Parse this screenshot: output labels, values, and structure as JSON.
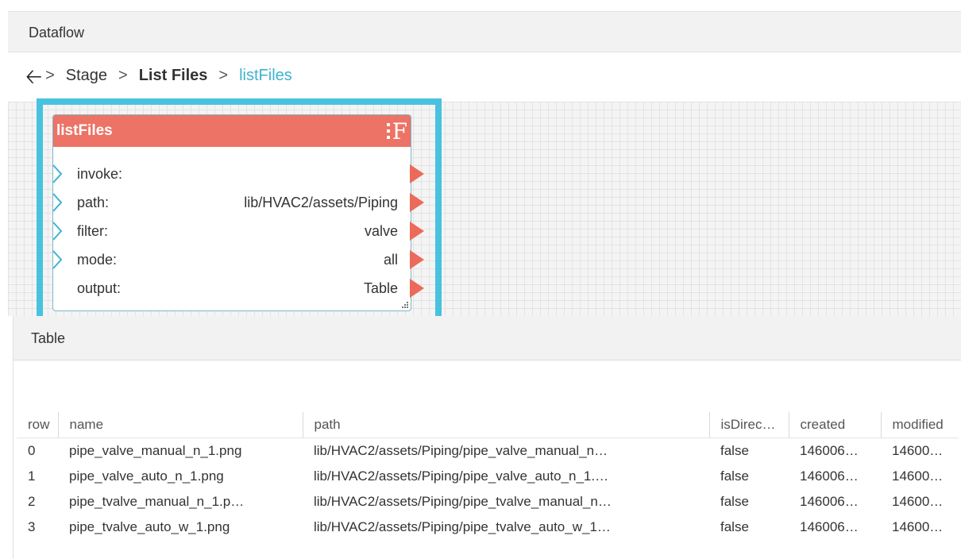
{
  "window": {
    "title": "Dataflow"
  },
  "breadcrumb": {
    "back_icon": "left-arrow-icon",
    "items": [
      "Stage",
      "List Files",
      "listFiles"
    ]
  },
  "node": {
    "name": "listFiles",
    "icon": "function-icon",
    "icon_glyph": "F",
    "header_color": "#ec7365",
    "params": [
      {
        "label": "invoke:",
        "value": ""
      },
      {
        "label": "path:",
        "value": "lib/HVAC2/assets/Piping"
      },
      {
        "label": "filter:",
        "value": "valve"
      },
      {
        "label": "mode:",
        "value": "all"
      },
      {
        "label": "output:",
        "value": "Table"
      }
    ]
  },
  "selection_color": "#48c2df",
  "table": {
    "title": "Table",
    "columns": [
      "row",
      "name",
      "path",
      "isDirec…",
      "created",
      "modified"
    ],
    "rows": [
      [
        "0",
        "pipe_valve_manual_n_1.png",
        "lib/HVAC2/assets/Piping/pipe_valve_manual_n…",
        "false",
        "146006…",
        "14600…"
      ],
      [
        "1",
        "pipe_valve_auto_n_1.png",
        "lib/HVAC2/assets/Piping/pipe_valve_auto_n_1.…",
        "false",
        "146006…",
        "14600…"
      ],
      [
        "2",
        "pipe_tvalve_manual_n_1.p…",
        "lib/HVAC2/assets/Piping/pipe_tvalve_manual_n…",
        "false",
        "146006…",
        "14600…"
      ],
      [
        "3",
        "pipe_tvalve_auto_w_1.png",
        "lib/HVAC2/assets/Piping/pipe_tvalve_auto_w_1…",
        "false",
        "146006…",
        "14600…"
      ]
    ]
  }
}
